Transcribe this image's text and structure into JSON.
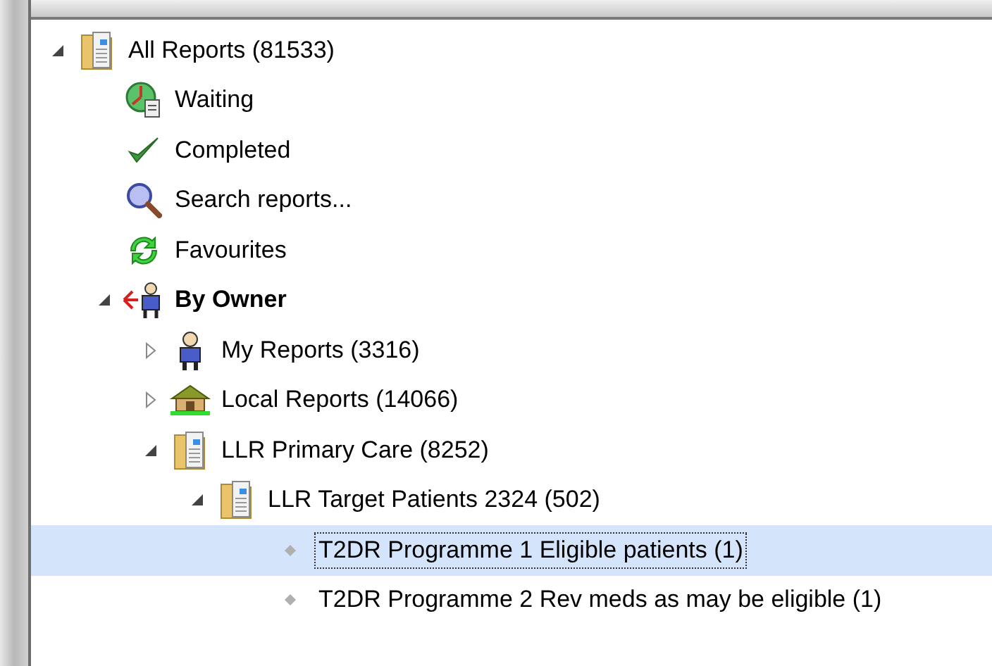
{
  "tree": [
    {
      "label": "All Reports (81533)",
      "kind": "folder",
      "expanded": true,
      "selected": false,
      "children": [
        {
          "label": "Waiting",
          "kind": "clock",
          "selected": false
        },
        {
          "label": "Completed",
          "kind": "check",
          "selected": false
        },
        {
          "label": "Search reports...",
          "kind": "search",
          "selected": false
        },
        {
          "label": "Favourites",
          "kind": "refresh",
          "selected": false
        },
        {
          "label": "By Owner",
          "kind": "owner",
          "expanded": true,
          "selected": false,
          "children": [
            {
              "label": "My Reports (3316)",
              "kind": "person",
              "expanded": false,
              "selected": false
            },
            {
              "label": "Local Reports (14066)",
              "kind": "house",
              "expanded": false,
              "selected": false
            },
            {
              "label": "LLR Primary Care (8252)",
              "kind": "folder",
              "expanded": true,
              "selected": false,
              "children": [
                {
                  "label": "LLR Target Patients 2324 (502)",
                  "kind": "folder",
                  "expanded": true,
                  "selected": false,
                  "children": [
                    {
                      "label": "T2DR Programme 1 Eligible patients (1)",
                      "kind": "report",
                      "selected": true
                    },
                    {
                      "label": "T2DR Programme 2 Rev meds as may be eligible (1)",
                      "kind": "report",
                      "selected": false
                    }
                  ]
                }
              ]
            }
          ]
        }
      ]
    }
  ]
}
